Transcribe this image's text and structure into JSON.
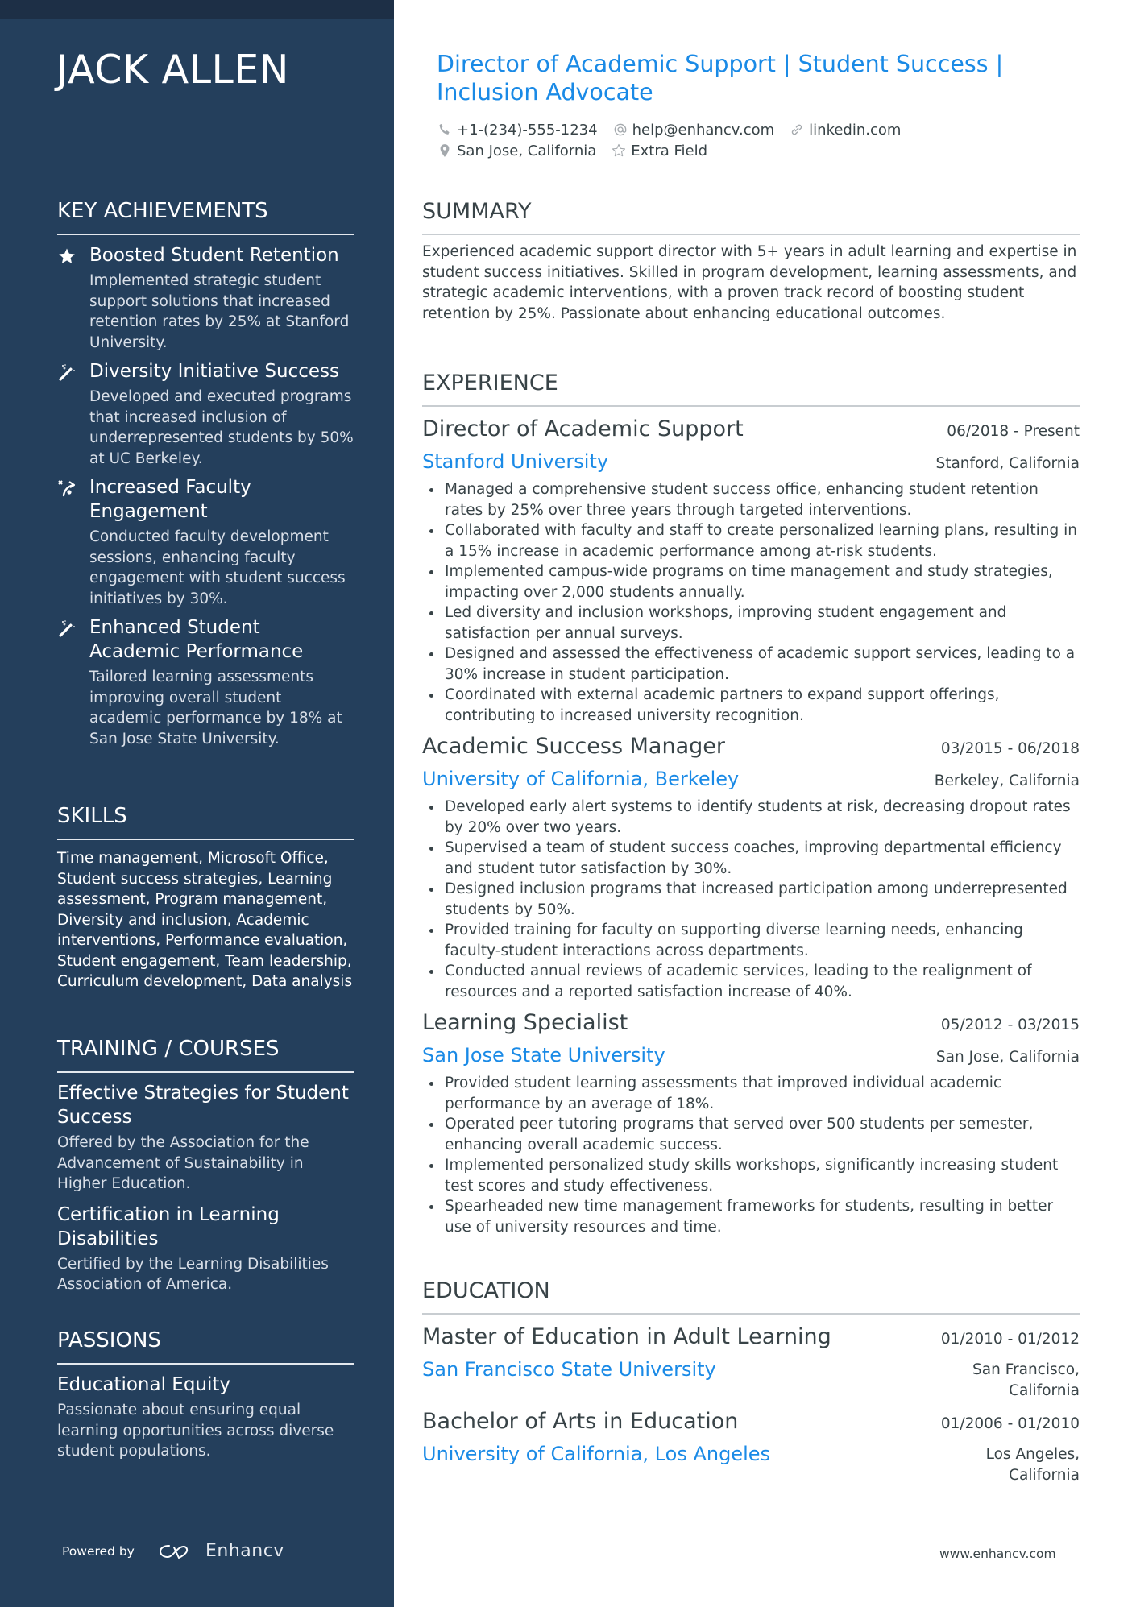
{
  "sidebar": {
    "name": "JACK ALLEN",
    "achievements": {
      "heading": "KEY ACHIEVEMENTS",
      "items": [
        {
          "icon": "star-icon",
          "title": "Boosted Student Retention",
          "desc": "Implemented strategic student support solutions that increased retention rates by 25% at Stanford University."
        },
        {
          "icon": "magic-wand-icon",
          "title": "Diversity Initiative Success",
          "desc": "Developed and executed programs that increased inclusion of underrepresented students by 50% at UC Berkeley."
        },
        {
          "icon": "strategy-arrow-icon",
          "title": "Increased Faculty Engagement",
          "desc": "Conducted faculty development sessions, enhancing faculty engagement with student success initiatives by 30%."
        },
        {
          "icon": "magic-wand-icon",
          "title": "Enhanced Student Academic Performance",
          "desc": "Tailored learning assessments improving overall student academic performance by 18% at San Jose State University."
        }
      ]
    },
    "skills": {
      "heading": "SKILLS",
      "text": "Time management, Microsoft Office, Student success strategies, Learning assessment, Program management, Diversity and inclusion, Academic interventions, Performance evaluation, Student engagement, Team leadership, Curriculum development, Data analysis"
    },
    "training": {
      "heading": "TRAINING / COURSES",
      "items": [
        {
          "title": "Effective Strategies for Student Success",
          "desc": "Offered by the Association for the Advancement of Sustainability in Higher Education."
        },
        {
          "title": "Certification in Learning Disabilities",
          "desc": "Certified by the Learning Disabilities Association of America."
        }
      ]
    },
    "passions": {
      "heading": "PASSIONS",
      "items": [
        {
          "title": "Educational Equity",
          "desc": "Passionate about ensuring equal learning opportunities across diverse student populations."
        }
      ]
    },
    "footer": {
      "powered_by": "Powered by",
      "brand": "Enhancv"
    }
  },
  "header": {
    "title": "Director of Academic Support | Student Success | Inclusion Advocate",
    "contacts": {
      "phone": "+1-(234)-555-1234",
      "email": "help@enhancv.com",
      "link": "linkedin.com",
      "location": "San Jose, California",
      "extra": "Extra Field"
    }
  },
  "summary": {
    "heading": "SUMMARY",
    "text": "Experienced academic support director with 5+ years in adult learning and expertise in student success initiatives. Skilled in program development, learning assessments, and strategic academic interventions, with a proven track record of boosting student retention by 25%. Passionate about enhancing educational outcomes."
  },
  "experience": {
    "heading": "EXPERIENCE",
    "jobs": [
      {
        "title": "Director of Academic Support",
        "dates": "06/2018 - Present",
        "org": "Stanford University",
        "location": "Stanford, California",
        "bullets": [
          "Managed a comprehensive student success office, enhancing student retention rates by 25% over three years through targeted interventions.",
          "Collaborated with faculty and staff to create personalized learning plans, resulting in a 15% increase in academic performance among at-risk students.",
          "Implemented campus-wide programs on time management and study strategies, impacting over 2,000 students annually.",
          "Led diversity and inclusion workshops, improving student engagement and satisfaction per annual surveys.",
          "Designed and assessed the effectiveness of academic support services, leading to a 30% increase in student participation.",
          "Coordinated with external academic partners to expand support offerings, contributing to increased university recognition."
        ]
      },
      {
        "title": "Academic Success Manager",
        "dates": "03/2015 - 06/2018",
        "org": "University of California, Berkeley",
        "location": "Berkeley, California",
        "bullets": [
          "Developed early alert systems to identify students at risk, decreasing dropout rates by 20% over two years.",
          "Supervised a team of student success coaches, improving departmental efficiency and student tutor satisfaction by 30%.",
          "Designed inclusion programs that increased participation among underrepresented students by 50%.",
          "Provided training for faculty on supporting diverse learning needs, enhancing faculty-student interactions across departments.",
          "Conducted annual reviews of academic services, leading to the realignment of resources and a reported satisfaction increase of 40%."
        ]
      },
      {
        "title": "Learning Specialist",
        "dates": "05/2012 - 03/2015",
        "org": "San Jose State University",
        "location": "San Jose, California",
        "bullets": [
          "Provided student learning assessments that improved individual academic performance by an average of 18%.",
          "Operated peer tutoring programs that served over 500 students per semester, enhancing overall academic success.",
          "Implemented personalized study skills workshops, significantly increasing student test scores and study effectiveness.",
          "Spearheaded new time management frameworks for students, resulting in better use of university resources and time."
        ]
      }
    ]
  },
  "education": {
    "heading": "EDUCATION",
    "items": [
      {
        "degree": "Master of Education in Adult Learning",
        "dates": "01/2010 - 01/2012",
        "school": "San Francisco State University",
        "location_line1": "San Francisco,",
        "location_line2": "California"
      },
      {
        "degree": "Bachelor of Arts in Education",
        "dates": "01/2006 - 01/2010",
        "school": "University of California, Los Angeles",
        "location_line1": "Los Angeles,",
        "location_line2": "California"
      }
    ]
  },
  "footer": {
    "website": "www.enhancv.com"
  },
  "colors": {
    "sidebar": "#243f5c",
    "topband": "#1d2f46",
    "accent": "#1a8ae6",
    "text": "#384347"
  }
}
